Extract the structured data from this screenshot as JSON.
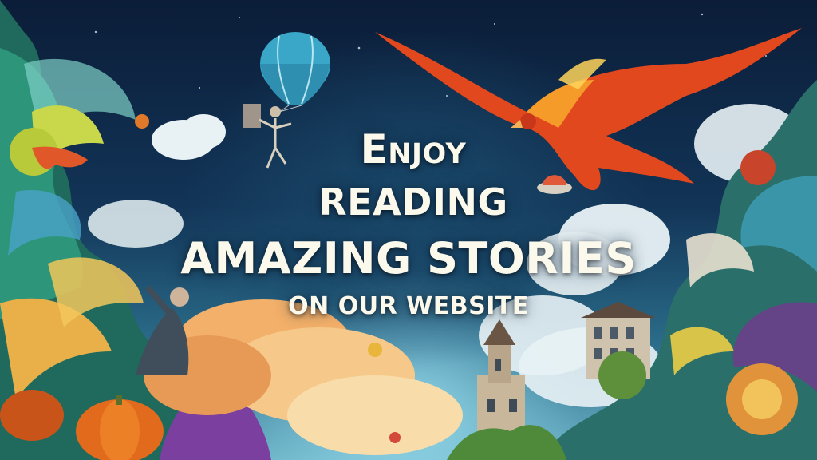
{
  "headline": {
    "line1": "Enjoy",
    "line2": "READING",
    "line3": "AMAZING STORIES",
    "line4": "ON OUR WEBSITE"
  },
  "colors": {
    "sky_top": "#0b1d38",
    "sky_mid": "#123457",
    "text": "#fbf8ec",
    "bird": "#e2481d",
    "balloon": "#3aa6c8"
  },
  "illustration": {
    "elements": [
      "phoenix-bird",
      "hot-air-balloon",
      "parachute-figure",
      "clouds",
      "castle-tower",
      "old-building",
      "swirling-foliage",
      "pumpkins",
      "flying-saucer"
    ]
  }
}
